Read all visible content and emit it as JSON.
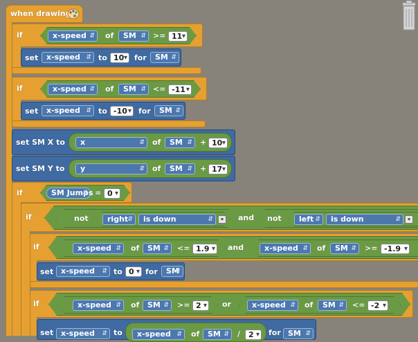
{
  "hat": {
    "label": "when drawing",
    "icon": "palette-icon"
  },
  "trash_icon": "trash-can-icon",
  "kw": {
    "if": "if",
    "set": "set",
    "to": "to",
    "for": "for",
    "of": "of",
    "and": "and",
    "or": "or",
    "not": "not",
    "is_down": "is down"
  },
  "blocks": {
    "if1": {
      "var": "x-speed",
      "sprite": "SM",
      "op": ">=",
      "value": "11"
    },
    "set1": {
      "var": "x-speed",
      "value": "10",
      "sprite": "SM"
    },
    "if2": {
      "var": "x-speed",
      "sprite": "SM",
      "op": "<=",
      "value": "-11"
    },
    "set2": {
      "var": "x-speed",
      "value": "-10",
      "sprite": "SM"
    },
    "setx": {
      "label": "set SM X to",
      "prop": "x",
      "sprite": "SM",
      "op": "+",
      "value": "10"
    },
    "sety": {
      "label": "set SM Y to",
      "prop": "y",
      "sprite": "SM",
      "op": "+",
      "value": "17"
    },
    "if3": {
      "var": "SM Jumps",
      "op": "=",
      "value": "0"
    },
    "if4": {
      "key1": "right",
      "key2": "left"
    },
    "if5": {
      "var1": "x-speed",
      "sprite1": "SM",
      "op1": "<=",
      "value1": "1.9",
      "var2": "x-speed",
      "sprite2": "SM",
      "op2": ">=",
      "value2": "-1.9"
    },
    "set5": {
      "var": "x-speed",
      "value": "0",
      "sprite": "SM"
    },
    "if6": {
      "var1": "x-speed",
      "sprite1": "SM",
      "op1": ">=",
      "value1": "2",
      "var2": "x-speed",
      "sprite2": "SM",
      "op2": "<=",
      "value2": "-2"
    },
    "set6": {
      "var": "x-speed",
      "var2": "x-speed",
      "sprite2": "SM",
      "op": "/",
      "value": "2",
      "sprite": "SM"
    }
  }
}
